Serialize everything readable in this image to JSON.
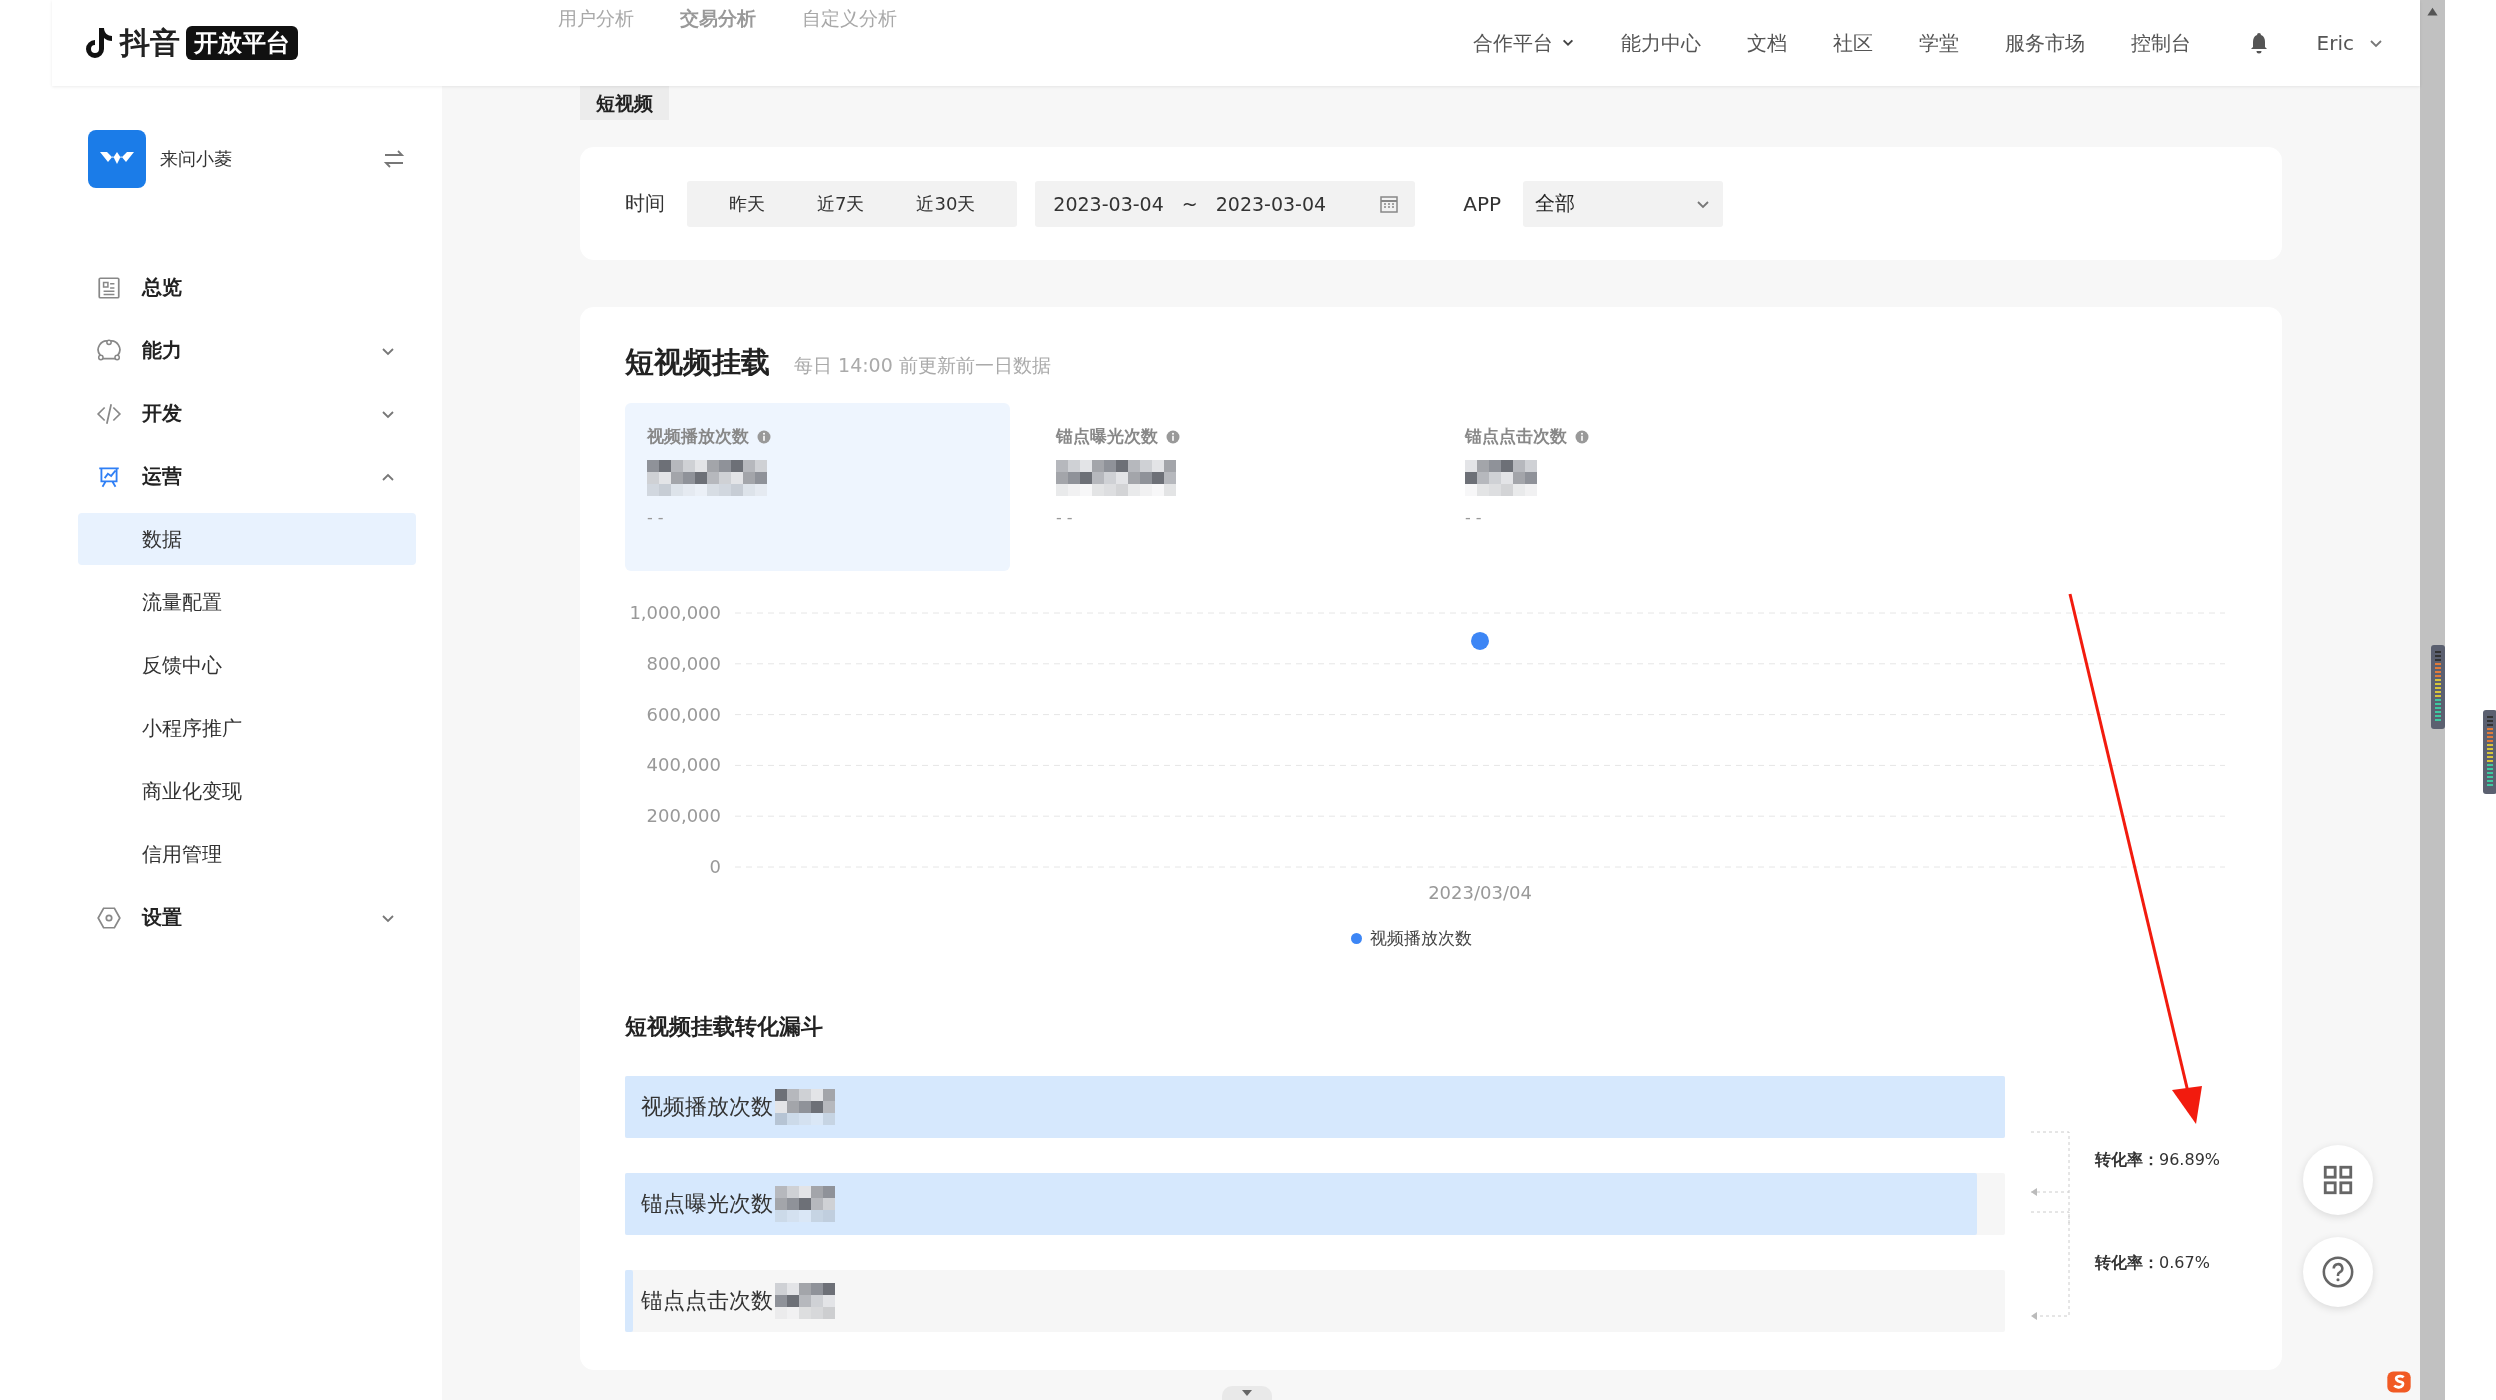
{
  "header": {
    "logo_text": "抖音",
    "logo_badge": "开放平台",
    "faded_tabs": [
      {
        "label": "用户分析",
        "selected": false
      },
      {
        "label": "交易分析",
        "selected": true
      },
      {
        "label": "自定义分析",
        "selected": false
      }
    ],
    "nav": [
      {
        "label": "合作平台",
        "dropdown": true
      },
      {
        "label": "能力中心",
        "dropdown": false
      },
      {
        "label": "文档",
        "dropdown": false
      },
      {
        "label": "社区",
        "dropdown": false
      },
      {
        "label": "学堂",
        "dropdown": false
      },
      {
        "label": "服务市场",
        "dropdown": false
      },
      {
        "label": "控制台",
        "dropdown": false
      }
    ],
    "user": "Eric"
  },
  "sidebar": {
    "app_name": "来问小菱",
    "items": [
      {
        "label": "总览",
        "has_children": false
      },
      {
        "label": "能力",
        "expanded": false,
        "has_children": true
      },
      {
        "label": "开发",
        "expanded": false,
        "has_children": true
      },
      {
        "label": "运营",
        "expanded": true,
        "has_children": true,
        "children": [
          {
            "label": "数据",
            "selected": true
          },
          {
            "label": "流量配置",
            "selected": false
          },
          {
            "label": "反馈中心",
            "selected": false
          },
          {
            "label": "小程序推广",
            "selected": false
          },
          {
            "label": "商业化变现",
            "selected": false
          },
          {
            "label": "信用管理",
            "selected": false
          }
        ]
      },
      {
        "label": "设置",
        "expanded": false,
        "has_children": true
      }
    ]
  },
  "page_tab": "短视频",
  "filters": {
    "time_label": "时间",
    "ranges": [
      {
        "label": "昨天",
        "selected": false
      },
      {
        "label": "近7天",
        "selected": false
      },
      {
        "label": "近30天",
        "selected": false
      }
    ],
    "start_date": "2023-03-04",
    "separator": "~",
    "end_date": "2023-03-04",
    "app_label": "APP",
    "app_value": "全部"
  },
  "section": {
    "title": "短视频挂载",
    "subtitle": "每日 14:00 前更新前一日数据",
    "stats": [
      {
        "label": "视频播放次数",
        "sub": "- -",
        "selected": true
      },
      {
        "label": "锚点曝光次数",
        "sub": "- -",
        "selected": false
      },
      {
        "label": "锚点点击次数",
        "sub": "- -",
        "selected": false
      }
    ],
    "chart_data": {
      "type": "scatter",
      "grid": true,
      "categories": [
        "2023/03/04"
      ],
      "series": [
        {
          "name": "视频播放次数",
          "color": "#3d86f5",
          "values": [
            890000
          ]
        }
      ],
      "ylim": [
        0,
        1000000
      ],
      "yticks": [
        {
          "value": 0,
          "label": "0"
        },
        {
          "value": 200000,
          "label": "200,000"
        },
        {
          "value": 400000,
          "label": "400,000"
        },
        {
          "value": 600000,
          "label": "600,000"
        },
        {
          "value": 800000,
          "label": "800,000"
        },
        {
          "value": 1000000,
          "label": "1,000,000"
        }
      ]
    },
    "funnel_title": "短视频挂载转化漏斗",
    "funnel": [
      {
        "label": "视频播放次数",
        "level": 1
      },
      {
        "label": "锚点曝光次数",
        "level": 0.98
      },
      {
        "label": "锚点点击次数",
        "level": 0.006
      }
    ],
    "conversions": [
      {
        "label": "转化率：",
        "value": "96.89%"
      },
      {
        "label": "转化率：",
        "value": "0.67%"
      }
    ]
  }
}
